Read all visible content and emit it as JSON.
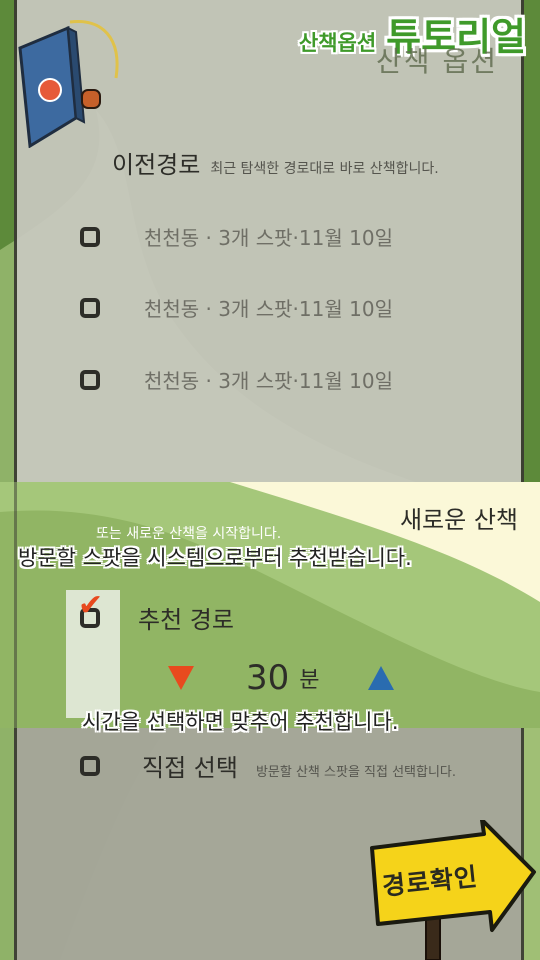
{
  "tutorial": {
    "sub": "산책옵션",
    "main": "튜토리얼"
  },
  "screen": {
    "title": "산책 옵션"
  },
  "previous": {
    "title": "이전경로",
    "desc": "최근 탐색한 경로대로 바로 산책합니다.",
    "routes": [
      {
        "label": "천천동 · 3개 스팟·11월 10일"
      },
      {
        "label": "천천동 · 3개 스팟·11월 10일"
      },
      {
        "label": "천천동 · 3개 스팟·11월 10일"
      }
    ]
  },
  "new_walk": {
    "title": "새로운 산책",
    "desc": "또는 새로운 산책을 시작합니다.",
    "callout_top": "방문할 스팟을 시스템으로부터 추천받습니다.",
    "recommend": {
      "label": "추천 경로",
      "checked": true
    },
    "time": {
      "value": "30",
      "unit": "분"
    },
    "callout_bottom": "시간을 선택하면 맞추어 추천합니다.",
    "direct": {
      "label": "직접 선택",
      "desc": "방문할 산책 스팟을 직접 선택합니다."
    }
  },
  "confirm": {
    "label": "경로확인"
  },
  "colors": {
    "accent_green": "#3f9a2a",
    "down_arrow": "#e84a1e",
    "up_arrow": "#2a6cb0",
    "sign_yellow": "#f5d31a"
  }
}
